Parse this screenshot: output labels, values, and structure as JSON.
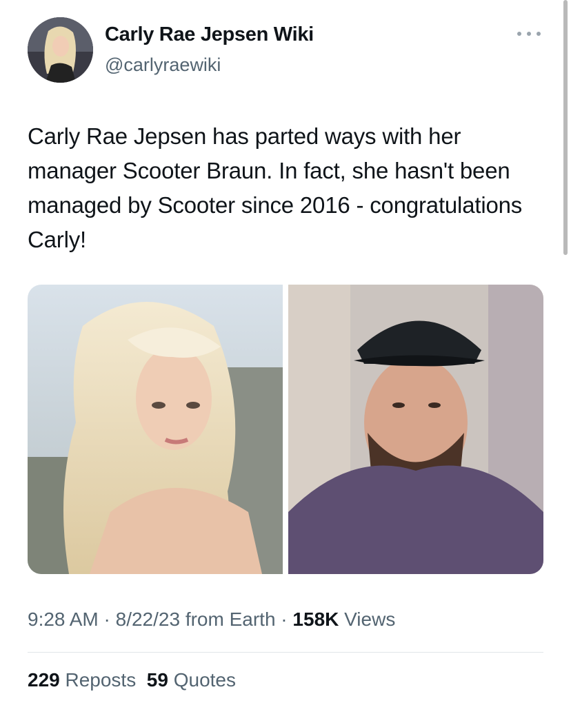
{
  "account": {
    "name": "Carly Rae Jepsen Wiki",
    "handle": "@carlyraewiki"
  },
  "tweet": {
    "text": "Carly Rae Jepsen has parted ways with her manager Scooter Braun. In fact, she hasn't been managed by Scooter since 2016 - congratulations Carly!"
  },
  "meta": {
    "time": "9:28 AM",
    "sep1": " · ",
    "date": "8/22/23",
    "source": " from Earth",
    "sep2": " · ",
    "views_count": "158K",
    "views_label": " Views"
  },
  "stats": {
    "reposts_count": "229",
    "reposts_label": " Reposts",
    "quotes_count": "59",
    "quotes_label": " Quotes"
  },
  "icons": {
    "more": "more-horizontal-icon"
  },
  "colors": {
    "text": "#0f1419",
    "secondary": "#536471",
    "divider": "#e1e5e8"
  }
}
